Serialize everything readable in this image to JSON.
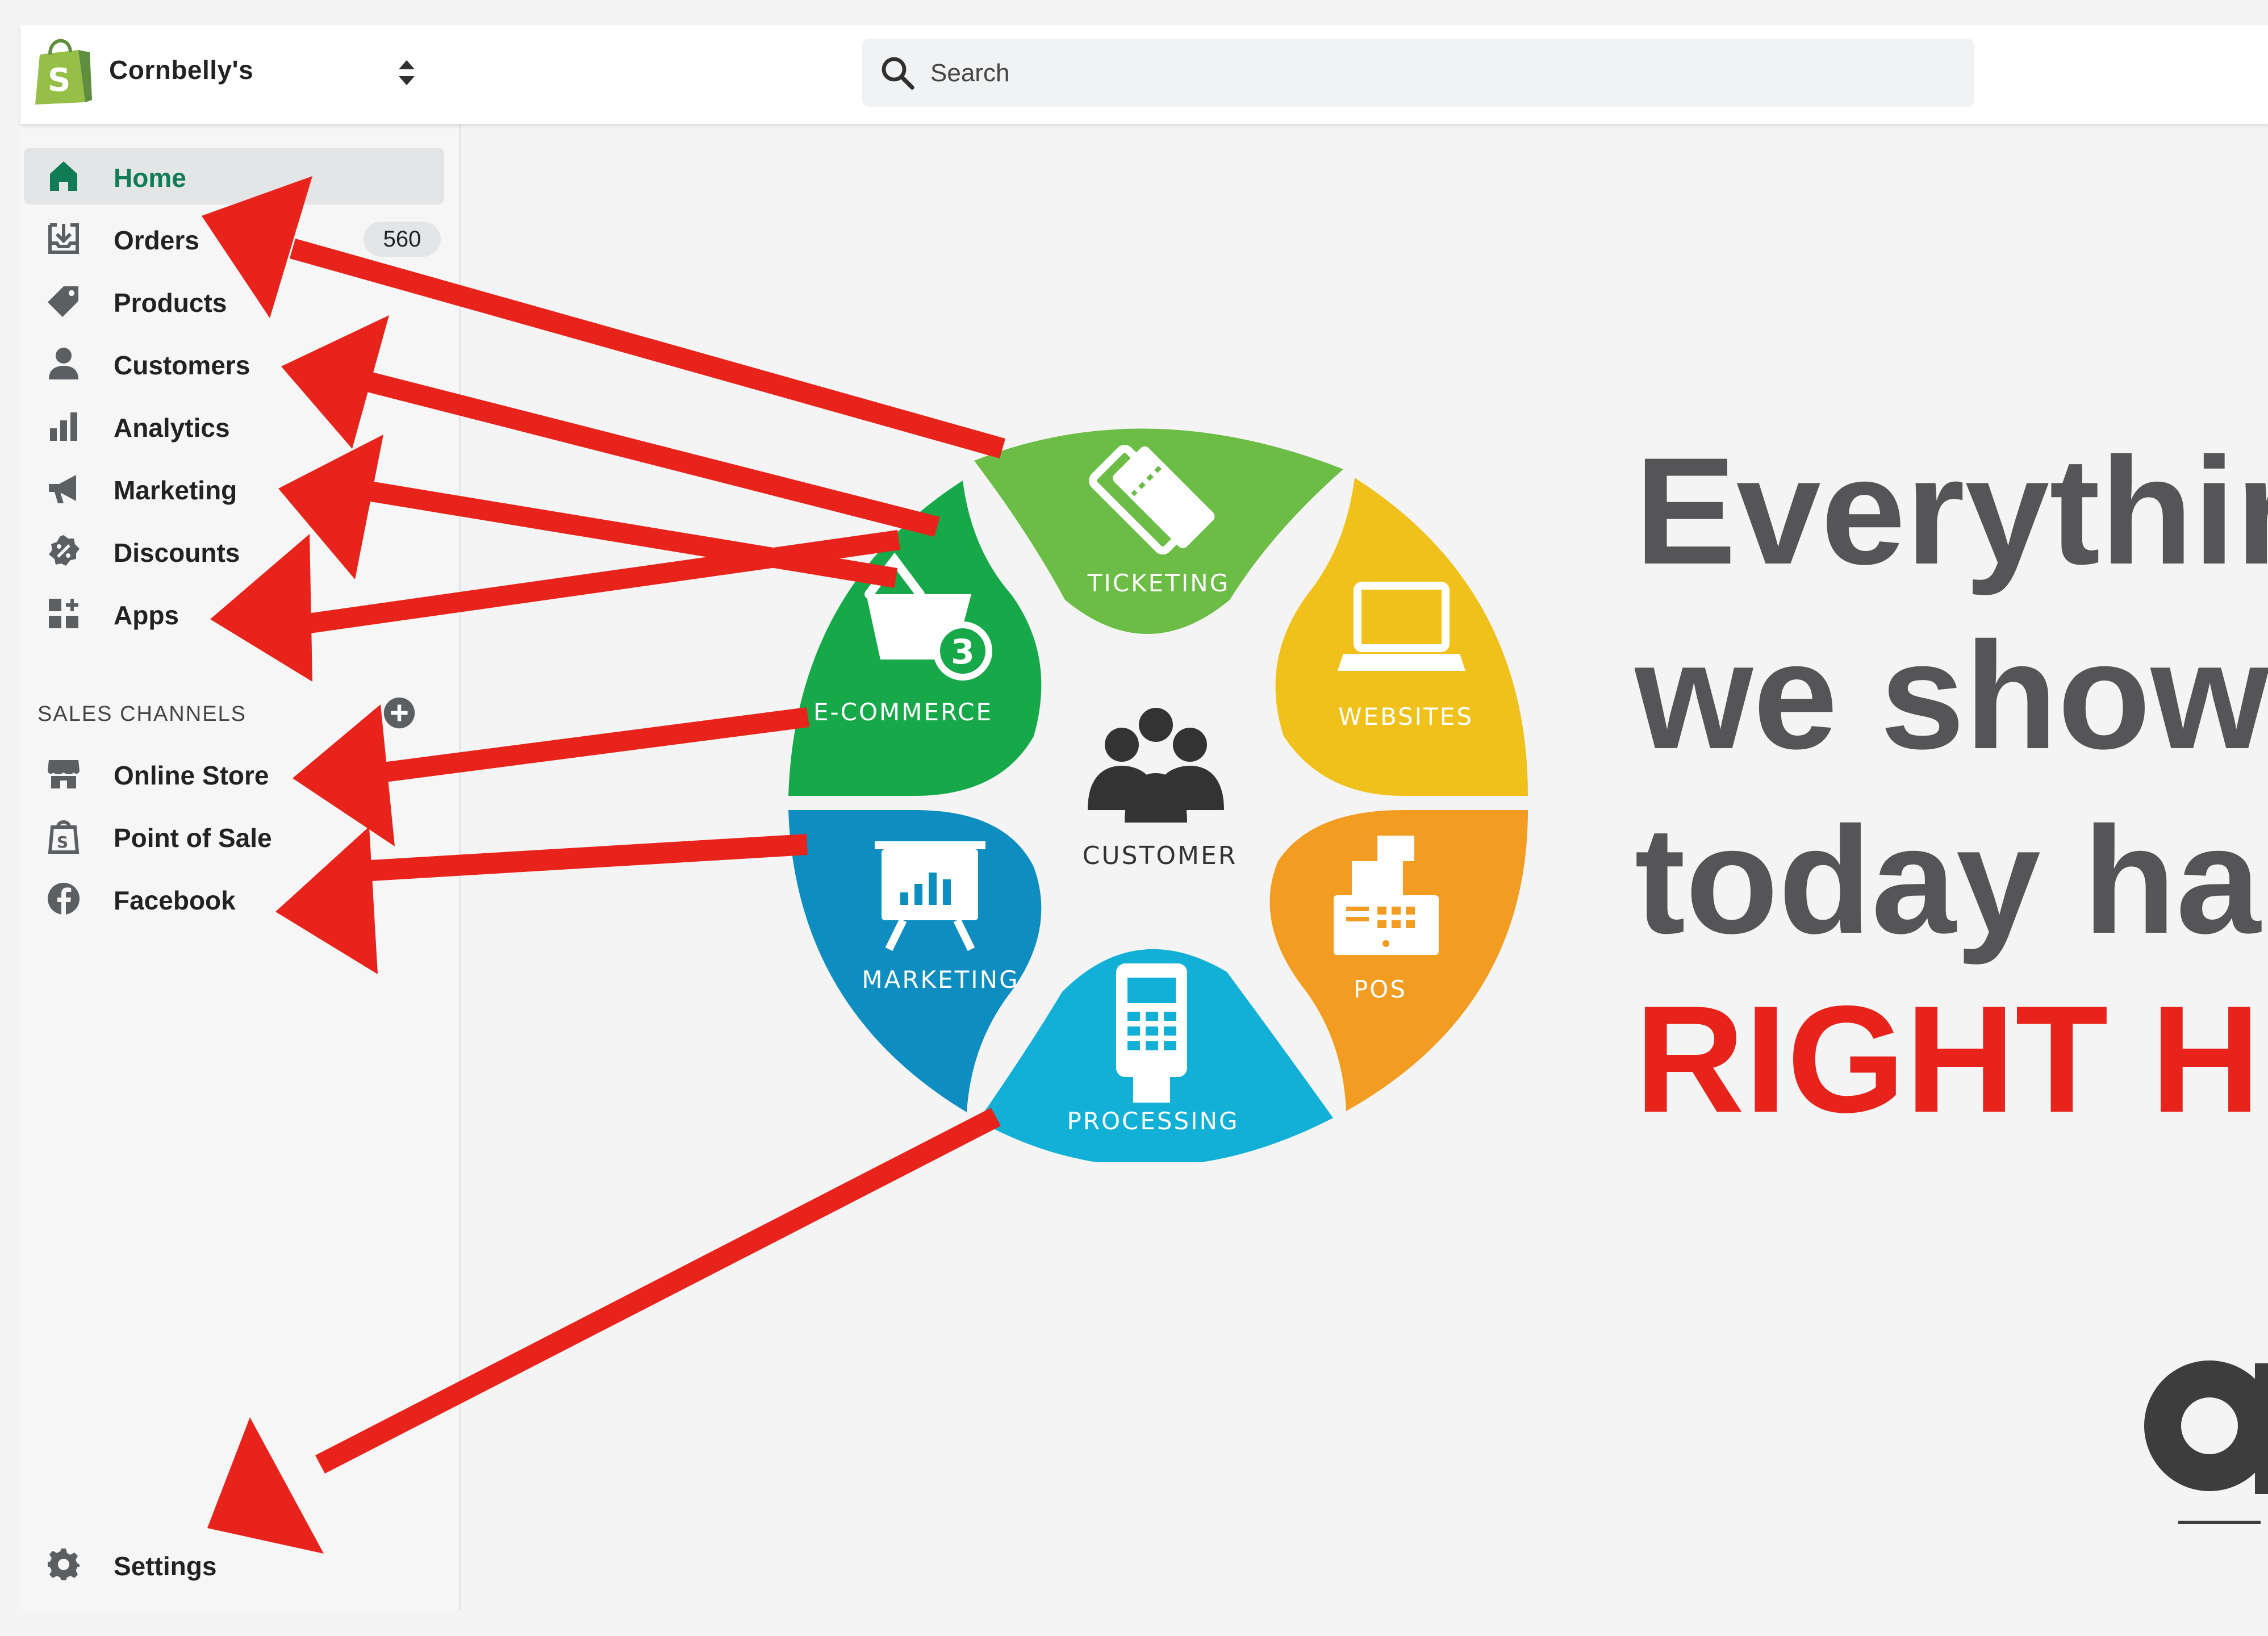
{
  "topbar": {
    "store_name": "Cornbelly's",
    "search": {
      "placeholder": "Search"
    }
  },
  "sidebar": {
    "items": [
      {
        "label": "Home",
        "icon": "home-icon",
        "active": true
      },
      {
        "label": "Orders",
        "icon": "orders-icon",
        "badge": "560"
      },
      {
        "label": "Products",
        "icon": "tag-icon"
      },
      {
        "label": "Customers",
        "icon": "person-icon"
      },
      {
        "label": "Analytics",
        "icon": "bar-chart-icon"
      },
      {
        "label": "Marketing",
        "icon": "megaphone-icon"
      },
      {
        "label": "Discounts",
        "icon": "discount-icon"
      },
      {
        "label": "Apps",
        "icon": "apps-icon"
      }
    ],
    "sales_channels": {
      "heading": "SALES CHANNELS",
      "items": [
        {
          "label": "Online Store",
          "icon": "store-icon"
        },
        {
          "label": "Point of Sale",
          "icon": "pos-bag-icon"
        },
        {
          "label": "Facebook",
          "icon": "facebook-icon"
        }
      ]
    },
    "settings": {
      "label": "Settings",
      "icon": "gear-icon"
    }
  },
  "wheel": {
    "center_label": "CUSTOMER",
    "cart_badge": "3",
    "segments": [
      {
        "label": "TICKETING",
        "color": "#6cbd45",
        "icon": "ticket-icon"
      },
      {
        "label": "WEBSITES",
        "color": "#f1c11b",
        "icon": "laptop-icon"
      },
      {
        "label": "POS",
        "color": "#f29d22",
        "icon": "cash-register-icon"
      },
      {
        "label": "PROCESSING",
        "color": "#12b0d6",
        "icon": "card-terminal-icon"
      },
      {
        "label": "MARKETING",
        "color": "#0e8dc0",
        "icon": "presentation-chart-icon"
      },
      {
        "label": "E-COMMERCE",
        "color": "#17a84a",
        "icon": "shopping-basket-icon"
      }
    ]
  },
  "headline": {
    "lines": [
      "Everythir",
      "we show",
      "today ha",
      "RIGHT H"
    ],
    "line_colors": [
      "#555557",
      "#555557",
      "#555557",
      "#e8231b"
    ]
  },
  "colors": {
    "accent_green": "#107c55",
    "arrow_red": "#e8231b",
    "shopify_green": "#95bf47"
  }
}
